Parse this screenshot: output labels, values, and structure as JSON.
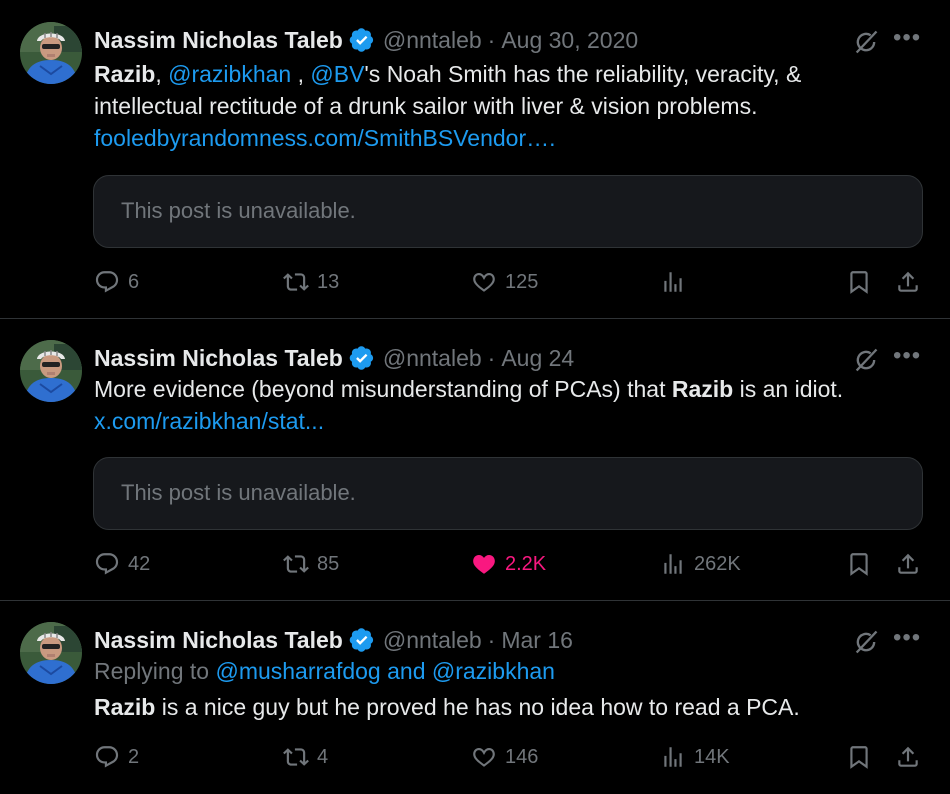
{
  "posts": [
    {
      "author": "Nassim Nicholas Taleb",
      "handle": "@nntaleb",
      "separator": "·",
      "date": "Aug 30, 2020",
      "text_parts": {
        "bold_start": "Razib",
        "comma": ", ",
        "mention1": "@razibkhan",
        "mid1": " , ",
        "mention2": "@BV",
        "rest": "'s Noah Smith has the reliability, veracity, &",
        "line2": "intellectual rectitude of a drunk sailor with liver & vision problems.",
        "url": "fooledbyrandomness.com/SmithBSVendor…."
      },
      "quote": "This post is unavailable.",
      "replies": "6",
      "reposts": "13",
      "likes": "125",
      "views": ""
    },
    {
      "author": "Nassim Nicholas Taleb",
      "handle": "@nntaleb",
      "separator": "·",
      "date": "Aug 24",
      "text_parts": {
        "pre": "More evidence (beyond misunderstanding of PCAs) that ",
        "bold": "Razib",
        "post": " is an idiot.",
        "url": "x.com/razibkhan/stat..."
      },
      "quote": "This post is unavailable.",
      "replies": "42",
      "reposts": "85",
      "likes": "2.2K",
      "views": "262K"
    },
    {
      "author": "Nassim Nicholas Taleb",
      "handle": "@nntaleb",
      "separator": "·",
      "date": "Mar 16",
      "replying_prefix": "Replying to ",
      "replying_to": "@musharrafdog and @razibkhan",
      "text_parts": {
        "bold": "Razib",
        "post": " is a nice guy but he proved he has no idea how to read a PCA."
      },
      "replies": "2",
      "reposts": "4",
      "likes": "146",
      "views": "14K"
    }
  ],
  "colors": {
    "background": "#000000",
    "text": "#e7e9ea",
    "muted": "#71767b",
    "link": "#1d9bf0",
    "like_active": "#f91880",
    "verified": "#1d9bf0"
  },
  "icons": [
    "reply-icon",
    "repost-icon",
    "like-icon",
    "views-icon",
    "bookmark-icon",
    "share-icon",
    "grok-icon",
    "more-icon",
    "verified-badge-icon"
  ]
}
